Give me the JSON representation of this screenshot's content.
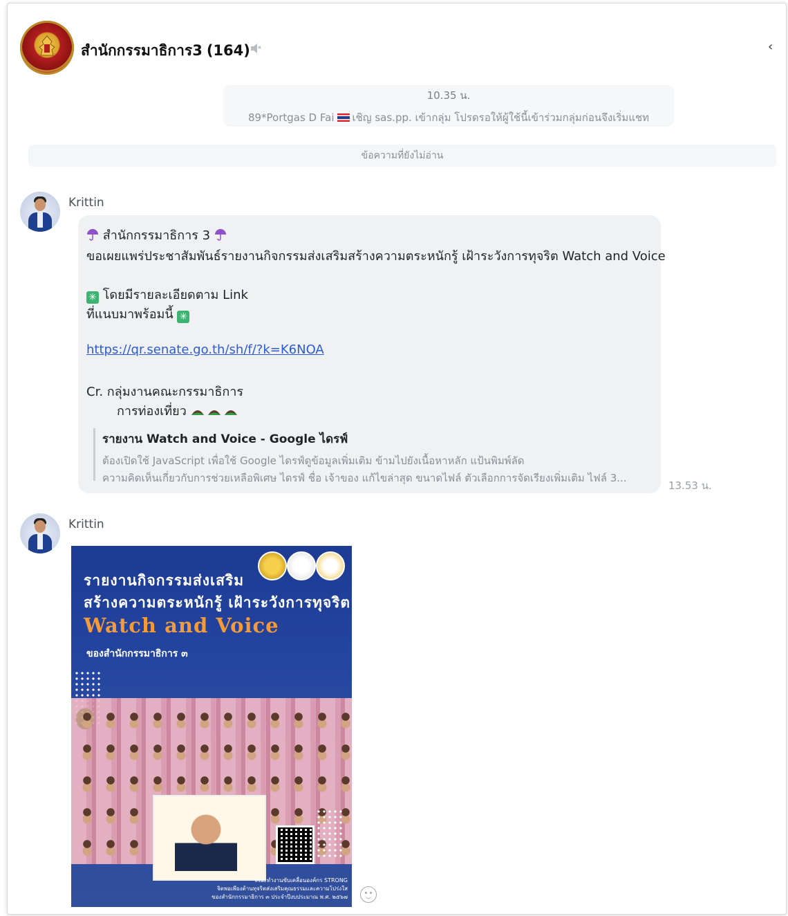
{
  "header": {
    "title": "สำนักกรรมาธิการ3",
    "member_count": "(164)",
    "mute_icon": "speaker-muted-icon",
    "collapse_icon": "chevron-left-icon"
  },
  "system_message": {
    "time": "10.35 น.",
    "text_before": "89*Portgas D Fai",
    "text_after": "เชิญ sas.pp. เข้ากลุ่ม โปรดรอให้ผู้ใช้นี้เข้าร่วมกลุ่มก่อนจึงเริ่มแชท"
  },
  "unread_divider": "ข้อความที่ยังไม่อ่าน",
  "messages": [
    {
      "sender": "Krittin",
      "lines": {
        "title": "สำนักกรรมาธิการ 3",
        "announce": "ขอเผยแพร่ประชาสัมพันธ์รายงานกิจกรรมส่งเสริมสร้างความตระหนักรู้ เฝ้าระวังการทุจริต Watch and Voice",
        "detail1": "โดยมีรายละเอียดตาม Link",
        "detail2": "ที่แนบมาพร้อมนี้",
        "link": "https://qr.senate.go.th/sh/f/?k=K6NOA",
        "credit1": "Cr. กลุ่มงานคณะกรรมาธิการ",
        "credit2": "การท่องเที่ยว"
      },
      "preview": {
        "title": "รายงาน Watch and Voice - Google ไดรฟ์",
        "desc1": "ต้องเปิดใช้ JavaScript เพื่อใช้ Google ไดรฟ์ดูข้อมูลเพิ่มเติม ข้ามไปยังเนื้อหาหลัก แป้นพิมพ์ลัด",
        "desc2": "ความคิดเห็นเกี่ยวกับการช่วยเหลือพิเศษ ไดรฟ์ ชื่อ เจ้าของ แก้ไขล่าสุด ขนาดไฟล์ ตัวเลือกการจัดเรียงเพิ่มเติม ไฟล์ 3..."
      },
      "time": "13.53 น."
    },
    {
      "sender": "Krittin",
      "poster": {
        "title1": "รายงานกิจกรรมส่งเสริม",
        "title2": "สร้างความตระหนักรู้ เฝ้าระวังการทุจริต",
        "highlight": "Watch and Voice",
        "subtitle": "ของสำนักกรรมาธิการ ๓",
        "footer1": "คณะทำงานขับเคลื่อนองค์กร STRONG",
        "footer2": "จิตพอเพียงต้านทุจริตส่งเสริมคุณธรรมและความโปร่งใส",
        "footer3": "ของสำนักกรรมาธิการ ๓ ประจำปีงบประมาณ พ.ศ. ๒๕๖๗"
      }
    }
  ],
  "colors": {
    "bubble": "#f0f1f3",
    "link": "#2b5bd7",
    "poster_bg": "#23449f",
    "poster_accent": "#f39b3a"
  }
}
